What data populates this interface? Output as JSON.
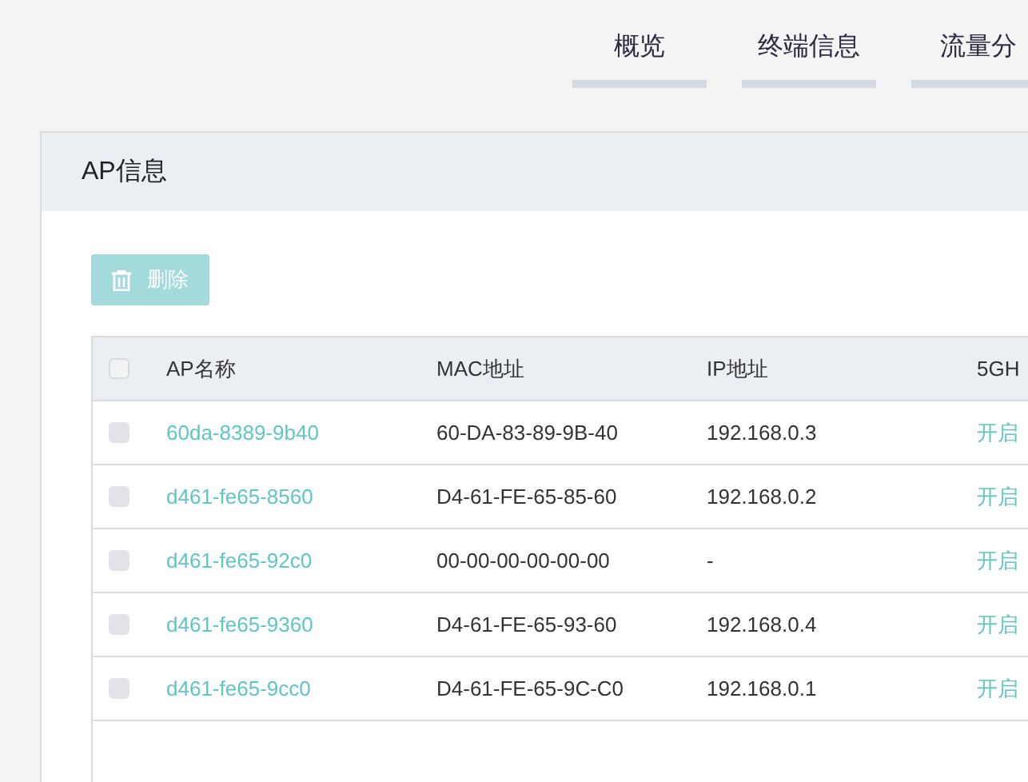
{
  "tabs": [
    {
      "label": "概览",
      "selected": false
    },
    {
      "label": "终端信息",
      "selected": false
    },
    {
      "label": "流量分",
      "selected": false
    }
  ],
  "panel": {
    "title": "AP信息",
    "delete_button": {
      "label": "删除",
      "disabled": true
    }
  },
  "table": {
    "select_all": {
      "checked": false
    },
    "columns": [
      "AP名称",
      "MAC地址",
      "IP地址",
      "5GH"
    ],
    "rows": [
      {
        "checked": false,
        "name": "60da-8389-9b40",
        "mac": "60-DA-83-89-9B-40",
        "ip": "192.168.0.3",
        "band_5ghz": "开启"
      },
      {
        "checked": false,
        "name": "d461-fe65-8560",
        "mac": "D4-61-FE-65-85-60",
        "ip": "192.168.0.2",
        "band_5ghz": "开启"
      },
      {
        "checked": false,
        "name": "d461-fe65-92c0",
        "mac": "00-00-00-00-00-00",
        "ip": "-",
        "band_5ghz": "开启"
      },
      {
        "checked": false,
        "name": "d461-fe65-9360",
        "mac": "D4-61-FE-65-93-60",
        "ip": "192.168.0.4",
        "band_5ghz": "开启"
      },
      {
        "checked": false,
        "name": "d461-fe65-9cc0",
        "mac": "D4-61-FE-65-9C-C0",
        "ip": "192.168.0.1",
        "band_5ghz": "开启"
      }
    ]
  }
}
